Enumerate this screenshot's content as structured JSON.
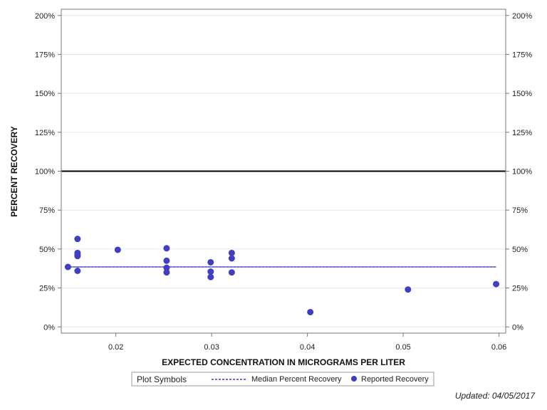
{
  "chart_data": {
    "type": "scatter",
    "xlabel": "EXPECTED CONCENTRATION IN MICROGRAMS PER LITER",
    "ylabel": "PERCENT RECOVERY",
    "xlim": [
      0.0143,
      0.0607
    ],
    "ylim": [
      -4,
      204
    ],
    "x_ticks": [
      0.02,
      0.03,
      0.04,
      0.05,
      0.06
    ],
    "x_tick_labels": [
      "0.02",
      "0.03",
      "0.04",
      "0.05",
      "0.06"
    ],
    "y_ticks": [
      0,
      25,
      50,
      75,
      100,
      125,
      150,
      175,
      200
    ],
    "y_tick_labels": [
      "0%",
      "25%",
      "50%",
      "75%",
      "100%",
      "125%",
      "150%",
      "175%",
      "200%"
    ],
    "grid": true,
    "reference_line": 100,
    "median": {
      "name": "Median Percent Recovery",
      "value": 38.5,
      "x_range": [
        0.015,
        0.0597
      ],
      "color": "#3f3fbf"
    },
    "series": [
      {
        "name": "Reported Recovery",
        "color": "#3f3fbf",
        "points": [
          {
            "x": 0.015,
            "y": 38.5
          },
          {
            "x": 0.016,
            "y": 56.5
          },
          {
            "x": 0.016,
            "y": 47.5
          },
          {
            "x": 0.016,
            "y": 46.5
          },
          {
            "x": 0.016,
            "y": 45.5
          },
          {
            "x": 0.016,
            "y": 36.0
          },
          {
            "x": 0.0202,
            "y": 49.5
          },
          {
            "x": 0.0253,
            "y": 50.5
          },
          {
            "x": 0.0253,
            "y": 42.5
          },
          {
            "x": 0.0253,
            "y": 38.0
          },
          {
            "x": 0.0253,
            "y": 35.0
          },
          {
            "x": 0.0299,
            "y": 41.5
          },
          {
            "x": 0.0299,
            "y": 35.5
          },
          {
            "x": 0.0299,
            "y": 32.0
          },
          {
            "x": 0.0321,
            "y": 47.5
          },
          {
            "x": 0.0321,
            "y": 44.0
          },
          {
            "x": 0.0321,
            "y": 35.0
          },
          {
            "x": 0.0403,
            "y": 9.5
          },
          {
            "x": 0.0505,
            "y": 24.0
          },
          {
            "x": 0.0597,
            "y": 27.5
          }
        ]
      }
    ],
    "legend": {
      "title": "Plot Symbols",
      "placement": "bottom",
      "items": [
        "Median Percent Recovery",
        "Reported Recovery"
      ]
    }
  },
  "footnote": "Updated: 04/05/2017",
  "colors": {
    "marker": "#3f3fbf",
    "reference": "#000000",
    "grid": "#e6e6e6",
    "axis": "#777777"
  }
}
